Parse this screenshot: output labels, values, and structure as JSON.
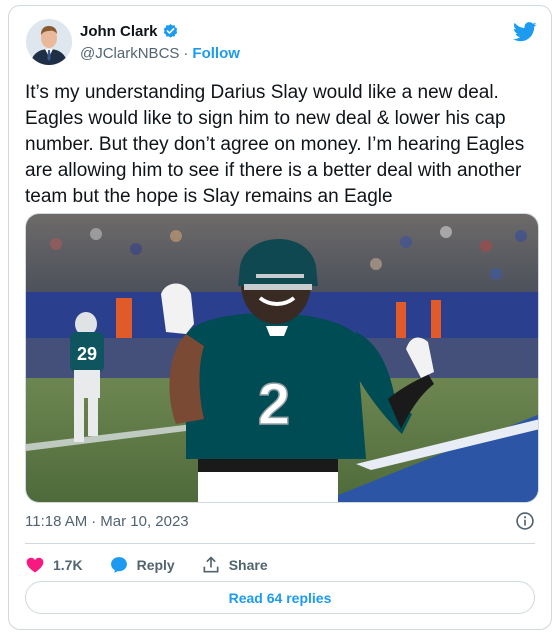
{
  "author": {
    "name": "John Clark",
    "handle": "@JClarkNBCS",
    "separator": "·",
    "follow_label": "Follow"
  },
  "tweet": {
    "text": "It’s my understanding Darius Slay would like a new deal. Eagles would like to sign him to new deal & lower his cap number. But they don’t agree on money. I’m hearing Eagles are allowing him to see if there is a better deal with another team but the hope is Slay remains an Eagle",
    "time": "11:18 AM",
    "separator": "·",
    "date": "Mar 10, 2023"
  },
  "photo": {
    "jersey_number": "2",
    "background_jersey_number": "29"
  },
  "actions": {
    "like_count": "1.7K",
    "reply_label": "Reply",
    "share_label": "Share"
  },
  "read_replies_label": "Read 64 replies",
  "icons": {
    "twitter": "twitter-bird-icon",
    "verified": "verified-badge-icon",
    "info": "info-icon",
    "like": "heart-icon",
    "reply": "reply-bubble-icon",
    "share": "share-upload-icon"
  },
  "colors": {
    "brand_blue": "#1d9bf0",
    "like_pink": "#f91880",
    "text_primary": "#0f1419",
    "text_secondary": "#536471",
    "eagles_green": "#004c54"
  }
}
